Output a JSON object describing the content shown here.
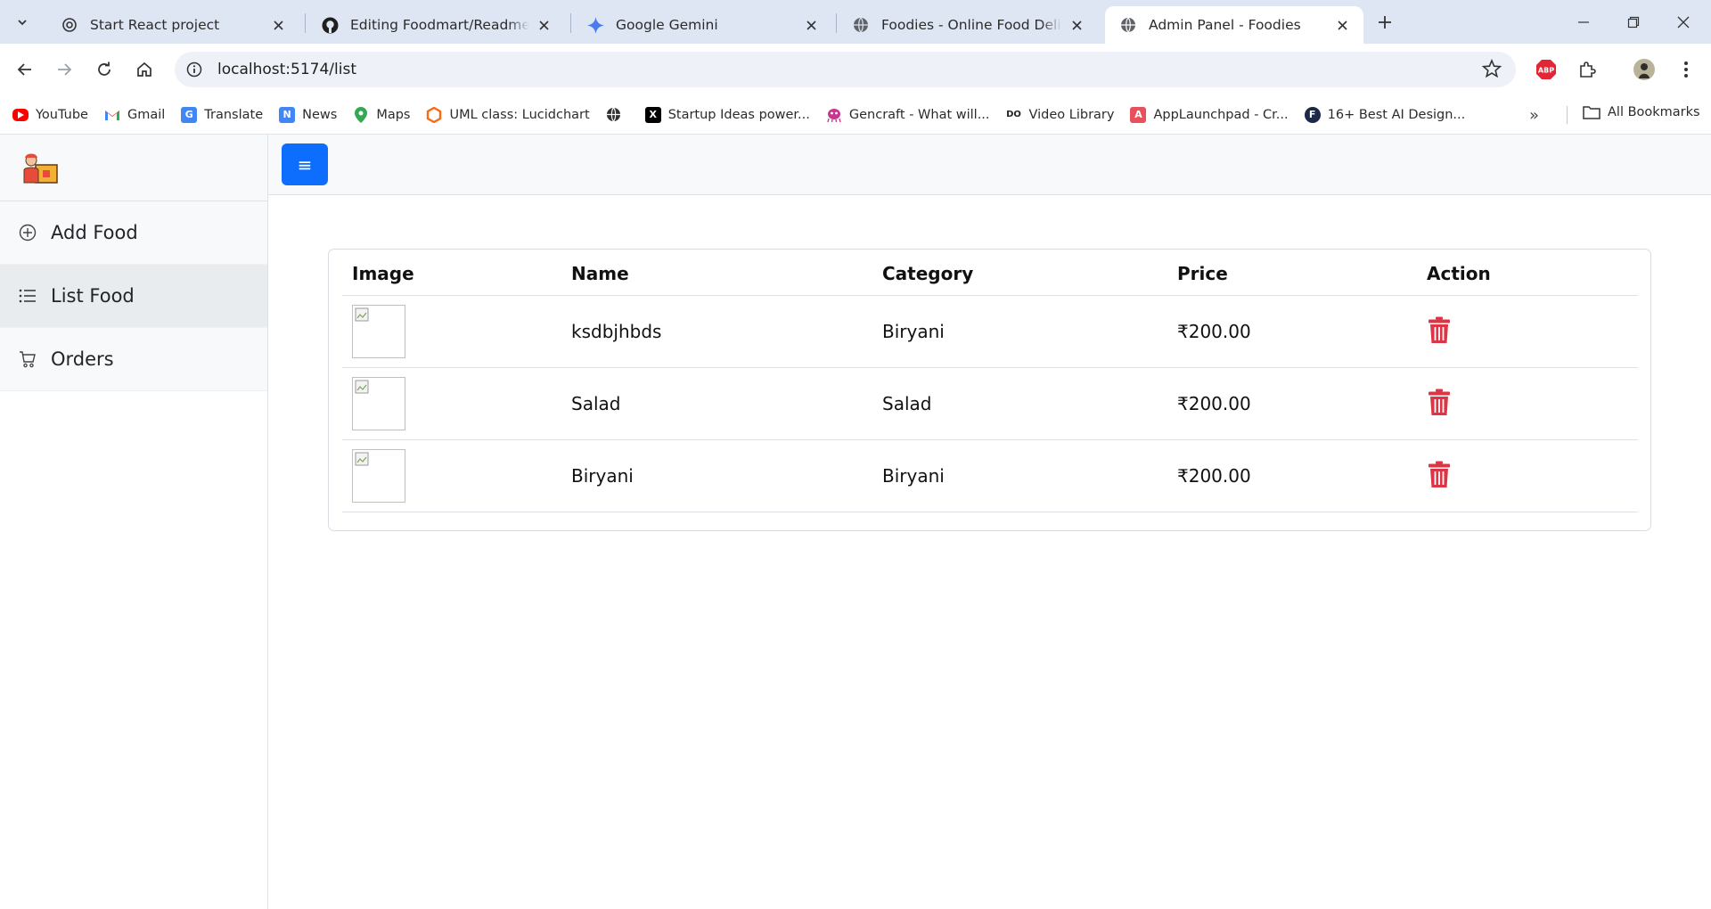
{
  "browser": {
    "tabs": [
      {
        "title": "Start React project",
        "icon": "chatgpt-icon"
      },
      {
        "title": "Editing Foodmart/Readme.md at",
        "icon": "github-icon"
      },
      {
        "title": "Google Gemini",
        "icon": "gemini-icon"
      },
      {
        "title": "Foodies - Online Food Delivery",
        "icon": "globe-icon"
      },
      {
        "title": "Admin Panel - Foodies",
        "icon": "globe-icon",
        "active": true
      }
    ],
    "url": "localhost:5174/list",
    "bookmarks": [
      {
        "label": "YouTube",
        "icon": "youtube-icon",
        "color": "#ff0000"
      },
      {
        "label": "Gmail",
        "icon": "gmail-icon",
        "color": "#ea4335"
      },
      {
        "label": "Translate",
        "icon": "translate-icon",
        "color": "#4285f4"
      },
      {
        "label": "News",
        "icon": "news-icon",
        "color": "#4285f4"
      },
      {
        "label": "Maps",
        "icon": "maps-icon",
        "color": "#34a853"
      },
      {
        "label": "UML class: Lucidchart",
        "icon": "lucidchart-icon",
        "color": "#f96b13"
      },
      {
        "label": "",
        "icon": "globe-icon",
        "color": "#333333"
      },
      {
        "label": "Startup Ideas power...",
        "icon": "x-icon",
        "color": "#000000"
      },
      {
        "label": "Gencraft - What will...",
        "icon": "gencraft-icon",
        "color": "#c8378f"
      },
      {
        "label": "Video Library",
        "icon": "video-library-icon",
        "color": "#222222"
      },
      {
        "label": "AppLaunchpad - Cr...",
        "icon": "applaunchpad-icon",
        "color": "#e8505b"
      },
      {
        "label": "16+ Best AI Design...",
        "icon": "f-icon",
        "color": "#1b2a4a"
      }
    ],
    "all_bookmarks": "All Bookmarks",
    "extension_badge": "ABP"
  },
  "sidebar": {
    "items": [
      {
        "label": "Add Food",
        "icon": "plus-circle-icon"
      },
      {
        "label": "List Food",
        "icon": "list-icon",
        "active": true
      },
      {
        "label": "Orders",
        "icon": "cart-icon"
      }
    ]
  },
  "topbar": {
    "menu_icon": "≡"
  },
  "table": {
    "headers": [
      "Image",
      "Name",
      "Category",
      "Price",
      "Action"
    ],
    "rows": [
      {
        "name": "ksdbjhbds",
        "category": "Biryani",
        "price": "₹200.00"
      },
      {
        "name": "Salad",
        "category": "Salad",
        "price": "₹200.00"
      },
      {
        "name": "Biryani",
        "category": "Biryani",
        "price": "₹200.00"
      }
    ]
  },
  "colors": {
    "primary": "#0d6efd",
    "danger": "#dc3545",
    "tabstrip": "#dfe6f3"
  }
}
